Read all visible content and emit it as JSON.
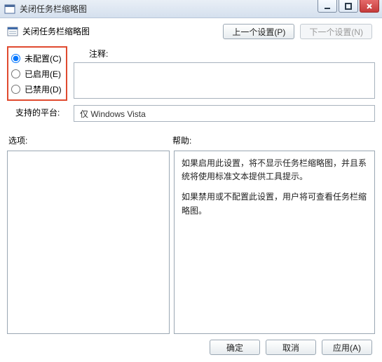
{
  "window": {
    "title": "关闭任务栏缩略图"
  },
  "policy": {
    "title": "关闭任务栏缩略图"
  },
  "nav": {
    "prev": "上一个设置(P)",
    "next": "下一个设置(N)"
  },
  "state": {
    "not_configured": "未配置(C)",
    "enabled": "已启用(E)",
    "disabled": "已禁用(D)",
    "selected": "not_configured"
  },
  "comment": {
    "label": "注释:",
    "value": ""
  },
  "platform": {
    "label": "支持的平台:",
    "value": "仅 Windows Vista"
  },
  "labels": {
    "options": "选项:",
    "help": "帮助:"
  },
  "help": {
    "p1": "如果启用此设置，将不显示任务栏缩略图，并且系统将使用标准文本提供工具提示。",
    "p2": "如果禁用或不配置此设置，用户将可查看任务栏缩略图。"
  },
  "buttons": {
    "ok": "确定",
    "cancel": "取消",
    "apply": "应用(A)"
  }
}
